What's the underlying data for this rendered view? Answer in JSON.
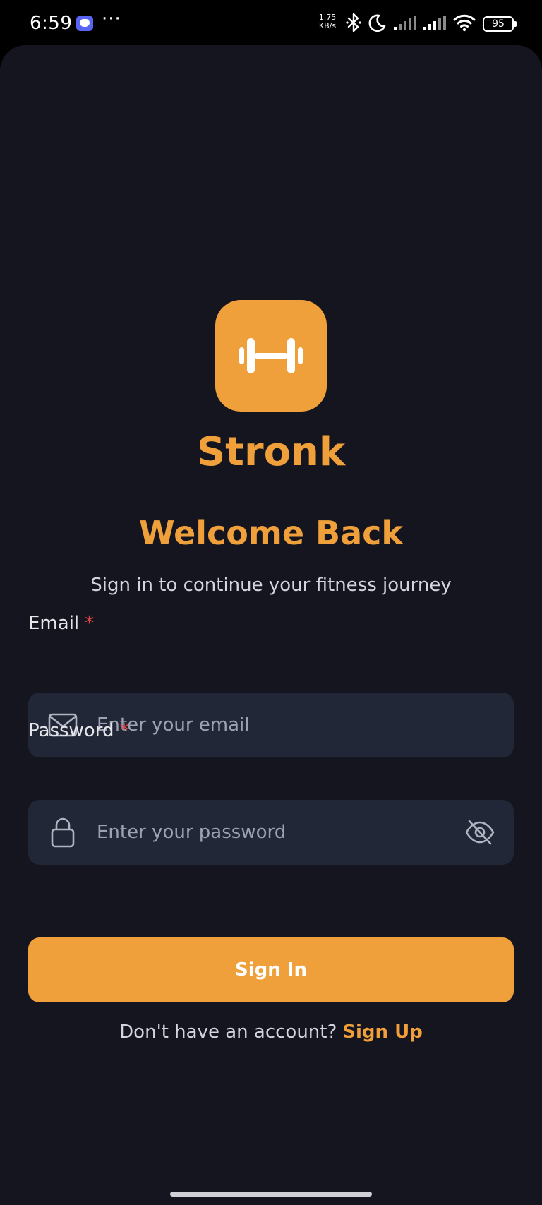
{
  "status_bar": {
    "time": "6:59",
    "more": "···",
    "net_speed_value": "1.75",
    "net_speed_unit": "KB/s",
    "battery": "95"
  },
  "app": {
    "name": "Stronk",
    "logo_icon": "dumbbell-icon",
    "accent_color": "#f0a03a"
  },
  "header": {
    "title": "Welcome Back",
    "subtitle": "Sign in to continue your fitness journey"
  },
  "form": {
    "email": {
      "label": "Email",
      "required_mark": "*",
      "placeholder": "Enter your email",
      "value": "",
      "icon": "mail-icon"
    },
    "password": {
      "label": "Password",
      "required_mark": "*",
      "placeholder": "Enter your password",
      "value": "",
      "icon": "lock-icon",
      "toggle_icon": "eye-off-icon"
    },
    "submit_label": "Sign In"
  },
  "footer": {
    "prompt": "Don't have an account?",
    "link_label": "Sign Up"
  }
}
